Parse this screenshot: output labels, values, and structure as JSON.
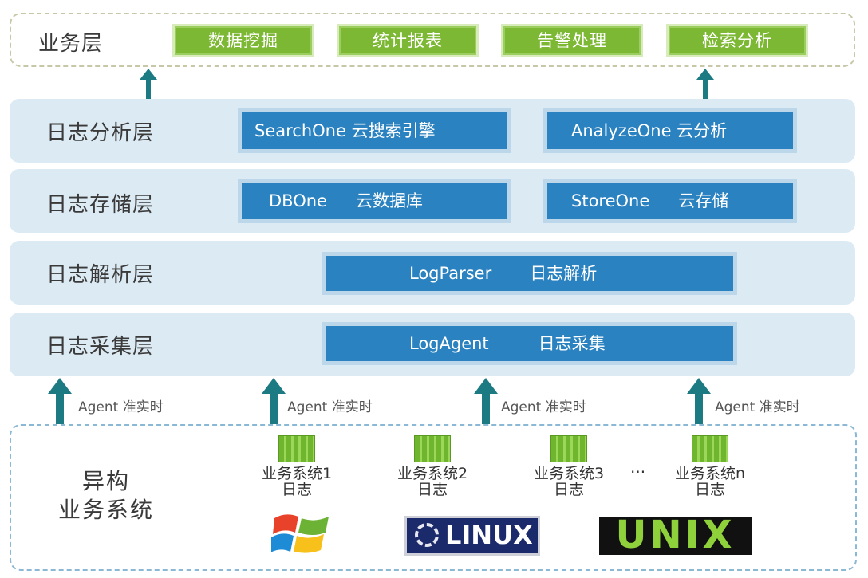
{
  "business_layer": {
    "label": "业务层",
    "items": [
      "数据挖掘",
      "统计报表",
      "告警处理",
      "检索分析"
    ]
  },
  "analysis_layer": {
    "label": "日志分析层",
    "boxes": [
      "SearchOne 云搜索引擎",
      "AnalyzeOne 云分析"
    ]
  },
  "storage_layer": {
    "label": "日志存储层",
    "boxes": [
      {
        "name": "DBOne",
        "desc": "云数据库"
      },
      {
        "name": "StoreOne",
        "desc": "云存储"
      }
    ]
  },
  "parse_layer": {
    "label": "日志解析层",
    "box": {
      "name": "LogParser",
      "desc": "日志解析"
    }
  },
  "collect_layer": {
    "label": "日志采集层",
    "box": {
      "name": "LogAgent",
      "desc": "日志采集"
    }
  },
  "agent_label": "Agent 准实时",
  "hetero": {
    "label_line1": "异构",
    "label_line2": "业务系统",
    "systems": [
      {
        "line1": "业务系统1",
        "line2": "日志"
      },
      {
        "line1": "业务系统2",
        "line2": "日志"
      },
      {
        "line1": "业务系统3",
        "line2": "日志"
      },
      {
        "line1": "业务系统n",
        "line2": "日志"
      }
    ],
    "ellipsis": "···"
  },
  "os_logos": {
    "linux": "LINUX",
    "unix": "UNIX"
  },
  "colors": {
    "green": "#7db834",
    "blue": "#2b82c0",
    "layer_bg": "#dceaf3",
    "arrow": "#1b7a82"
  }
}
